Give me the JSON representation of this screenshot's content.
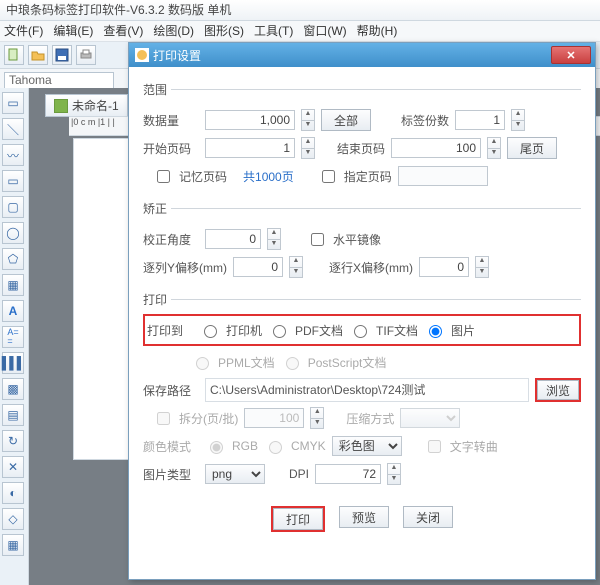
{
  "app": {
    "title": "中琅条码标签打印软件-V6.3.2 数码版 单机",
    "menus": [
      "文件(F)",
      "编辑(E)",
      "查看(V)",
      "绘图(D)",
      "图形(S)",
      "工具(T)",
      "窗口(W)",
      "帮助(H)"
    ],
    "font_name": "Tahoma",
    "doc_tab": "未命名-1",
    "ruler": "|0 c m |1 | |"
  },
  "dialog": {
    "title": "打印设置",
    "range": {
      "legend": "范围",
      "data_count_label": "数据量",
      "data_count": "1,000",
      "all_btn": "全部",
      "copies_label": "标签份数",
      "copies": "1",
      "start_label": "开始页码",
      "start": "1",
      "end_label": "结束页码",
      "end": "100",
      "lastpage_btn": "尾页",
      "remember_label": "记忆页码",
      "total_pages": "共1000页",
      "specify_label": "指定页码"
    },
    "correct": {
      "legend": "矫正",
      "angle_label": "校正角度",
      "angle": "0",
      "mirror_label": "水平镜像",
      "yoffset_label": "逐列Y偏移(mm)",
      "yoffset": "0",
      "xoffset_label": "逐行X偏移(mm)",
      "xoffset": "0"
    },
    "print": {
      "legend": "打印",
      "to_label": "打印到",
      "opt_printer": "打印机",
      "opt_pdf": "PDF文档",
      "opt_tif": "TIF文档",
      "opt_image": "图片",
      "opt_ppml": "PPML文档",
      "opt_ps": "PostScript文档",
      "path_label": "保存路径",
      "path_value": "C:\\Users\\Administrator\\Desktop\\724测试",
      "browse_btn": "浏览",
      "split_label": "拆分(页/批)",
      "split_value": "100",
      "compress_label": "压缩方式",
      "color_label": "颜色模式",
      "color_rgb": "RGB",
      "color_cmyk": "CMYK",
      "color_select": "彩色图",
      "text_warp": "文字转曲",
      "imgtype_label": "图片类型",
      "imgtype_value": "png",
      "dpi_label": "DPI",
      "dpi_value": "72"
    },
    "buttons": {
      "print": "打印",
      "preview": "预览",
      "close": "关闭"
    }
  }
}
